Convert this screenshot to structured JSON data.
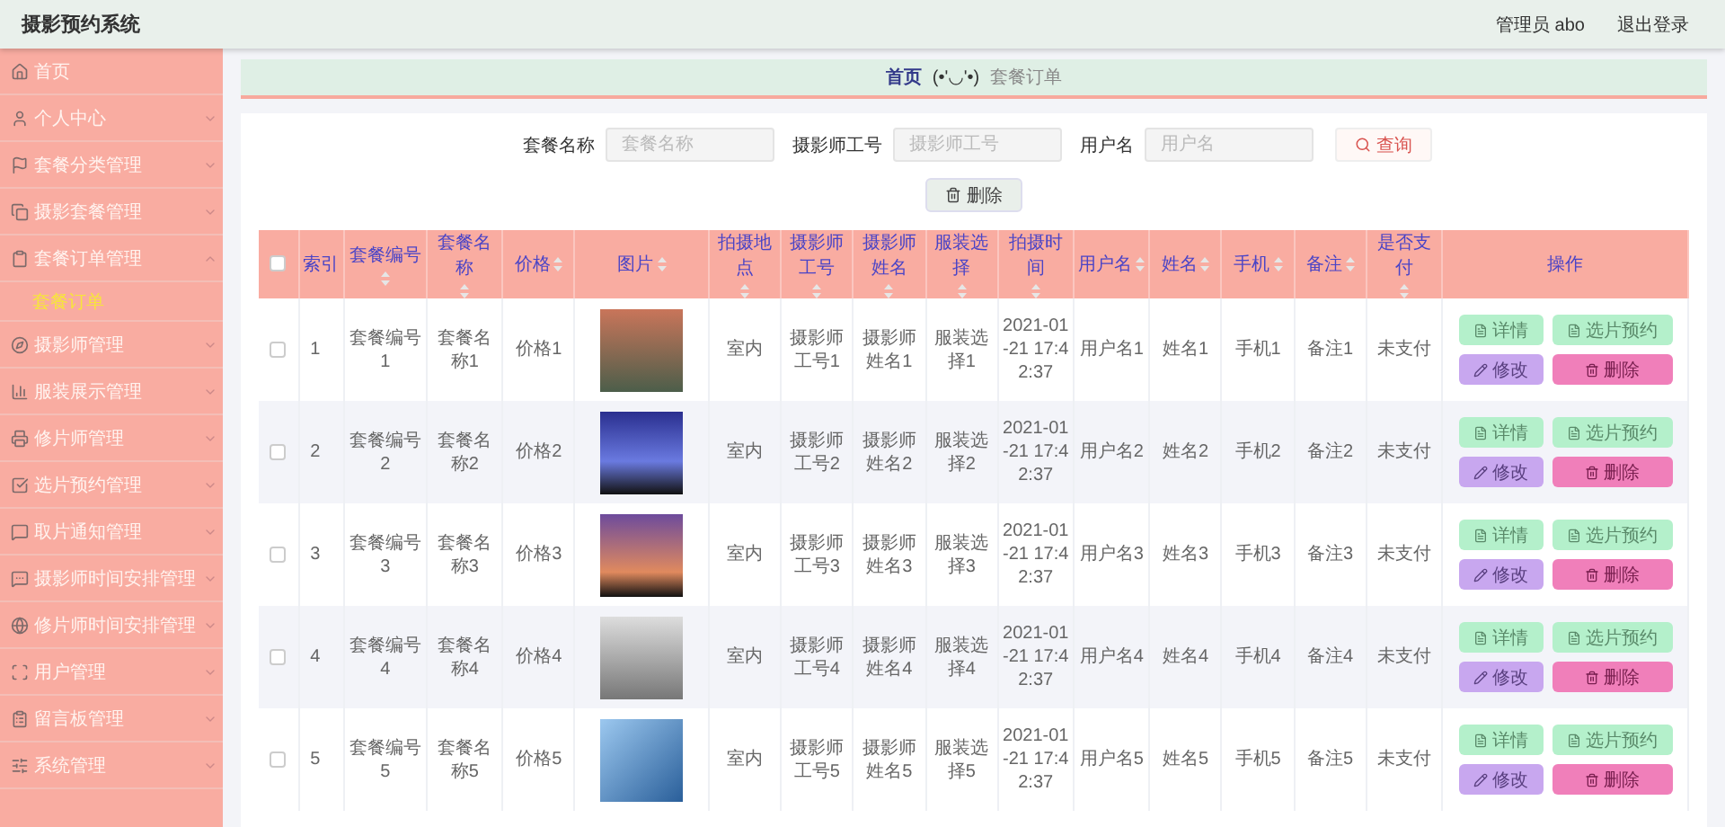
{
  "header": {
    "title": "摄影预约系统",
    "user": "管理员 abo",
    "logout": "退出登录"
  },
  "sidebar": {
    "items": [
      {
        "label": "首页",
        "kind": "link"
      },
      {
        "label": "个人中心",
        "kind": "menu",
        "expanded": false
      },
      {
        "label": "套餐分类管理",
        "kind": "menu",
        "expanded": false
      },
      {
        "label": "摄影套餐管理",
        "kind": "menu",
        "expanded": false
      },
      {
        "label": "套餐订单管理",
        "kind": "menu",
        "expanded": true,
        "children": [
          {
            "label": "套餐订单",
            "selected": true
          }
        ]
      },
      {
        "label": "摄影师管理",
        "kind": "menu",
        "expanded": false
      },
      {
        "label": "服装展示管理",
        "kind": "menu",
        "expanded": false
      },
      {
        "label": "修片师管理",
        "kind": "menu",
        "expanded": false
      },
      {
        "label": "选片预约管理",
        "kind": "menu",
        "expanded": false
      },
      {
        "label": "取片通知管理",
        "kind": "menu",
        "expanded": false
      },
      {
        "label": "摄影师时间安排管理",
        "kind": "menu",
        "expanded": false
      },
      {
        "label": "修片师时间安排管理",
        "kind": "menu",
        "expanded": false
      },
      {
        "label": "用户管理",
        "kind": "menu",
        "expanded": false
      },
      {
        "label": "留言板管理",
        "kind": "menu",
        "expanded": false
      },
      {
        "label": "系统管理",
        "kind": "menu",
        "expanded": false
      }
    ]
  },
  "breadcrumb": {
    "home": "首页",
    "face": "(•'◡'•)",
    "current": "套餐订单"
  },
  "search": {
    "fields": [
      {
        "label": "套餐名称",
        "placeholder": "套餐名称"
      },
      {
        "label": "摄影师工号",
        "placeholder": "摄影师工号"
      },
      {
        "label": "用户名",
        "placeholder": "用户名"
      }
    ],
    "search_button": "查询",
    "delete_button": "删除"
  },
  "table": {
    "select_all": {
      "checked": false
    },
    "columns": [
      {
        "label": "索引",
        "sortable": false
      },
      {
        "label": "套餐编号",
        "sortable": true
      },
      {
        "label": "套餐名称",
        "sortable": true
      },
      {
        "label": "价格",
        "sortable": true
      },
      {
        "label": "图片",
        "sortable": true
      },
      {
        "label": "拍摄地点",
        "sortable": true
      },
      {
        "label": "摄影师工号",
        "sortable": true
      },
      {
        "label": "摄影师姓名",
        "sortable": true
      },
      {
        "label": "服装选择",
        "sortable": true
      },
      {
        "label": "拍摄时间",
        "sortable": true
      },
      {
        "label": "用户名",
        "sortable": true
      },
      {
        "label": "姓名",
        "sortable": true
      },
      {
        "label": "手机",
        "sortable": true
      },
      {
        "label": "备注",
        "sortable": true
      },
      {
        "label": "是否支付",
        "sortable": true
      },
      {
        "label": "操作",
        "sortable": false
      }
    ],
    "rows": [
      {
        "checked": false,
        "cells": [
          "1",
          "套餐编号1",
          "套餐名称1",
          "价格1",
          null,
          "室内",
          "摄影师工号1",
          "摄影师姓名1",
          "服装选择1",
          "2021-01-21 17:42:37",
          "用户名1",
          "姓名1",
          "手机1",
          "备注1",
          "未支付"
        ],
        "actions": [
          {
            "kind": "detail",
            "label": "详情"
          },
          {
            "kind": "select",
            "label": "选片预约"
          },
          {
            "kind": "edit",
            "label": "修改"
          },
          {
            "kind": "delete",
            "label": "删除"
          }
        ]
      },
      {
        "checked": false,
        "cells": [
          "2",
          "套餐编号2",
          "套餐名称2",
          "价格2",
          null,
          "室内",
          "摄影师工号2",
          "摄影师姓名2",
          "服装选择2",
          "2021-01-21 17:42:37",
          "用户名2",
          "姓名2",
          "手机2",
          "备注2",
          "未支付"
        ],
        "actions": [
          {
            "kind": "detail",
            "label": "详情"
          },
          {
            "kind": "select",
            "label": "选片预约"
          },
          {
            "kind": "edit",
            "label": "修改"
          },
          {
            "kind": "delete",
            "label": "删除"
          }
        ]
      },
      {
        "checked": false,
        "cells": [
          "3",
          "套餐编号3",
          "套餐名称3",
          "价格3",
          null,
          "室内",
          "摄影师工号3",
          "摄影师姓名3",
          "服装选择3",
          "2021-01-21 17:42:37",
          "用户名3",
          "姓名3",
          "手机3",
          "备注3",
          "未支付"
        ],
        "actions": [
          {
            "kind": "detail",
            "label": "详情"
          },
          {
            "kind": "select",
            "label": "选片预约"
          },
          {
            "kind": "edit",
            "label": "修改"
          },
          {
            "kind": "delete",
            "label": "删除"
          }
        ]
      },
      {
        "checked": false,
        "cells": [
          "4",
          "套餐编号4",
          "套餐名称4",
          "价格4",
          null,
          "室内",
          "摄影师工号4",
          "摄影师姓名4",
          "服装选择4",
          "2021-01-21 17:42:37",
          "用户名4",
          "姓名4",
          "手机4",
          "备注4",
          "未支付"
        ],
        "actions": [
          {
            "kind": "detail",
            "label": "详情"
          },
          {
            "kind": "select",
            "label": "选片预约"
          },
          {
            "kind": "edit",
            "label": "修改"
          },
          {
            "kind": "delete",
            "label": "删除"
          }
        ]
      },
      {
        "checked": false,
        "cells": [
          "5",
          "套餐编号5",
          "套餐名称5",
          "价格5",
          null,
          "室内",
          "摄影师工号5",
          "摄影师姓名5",
          "服装选择5",
          "2021-01-21 17:42:37",
          "用户名5",
          "姓名5",
          "手机5",
          "备注5",
          "未支付"
        ],
        "actions": [
          {
            "kind": "detail",
            "label": "详情"
          },
          {
            "kind": "select",
            "label": "选片预约"
          },
          {
            "kind": "edit",
            "label": "修改"
          },
          {
            "kind": "delete",
            "label": "删除"
          }
        ]
      }
    ]
  }
}
